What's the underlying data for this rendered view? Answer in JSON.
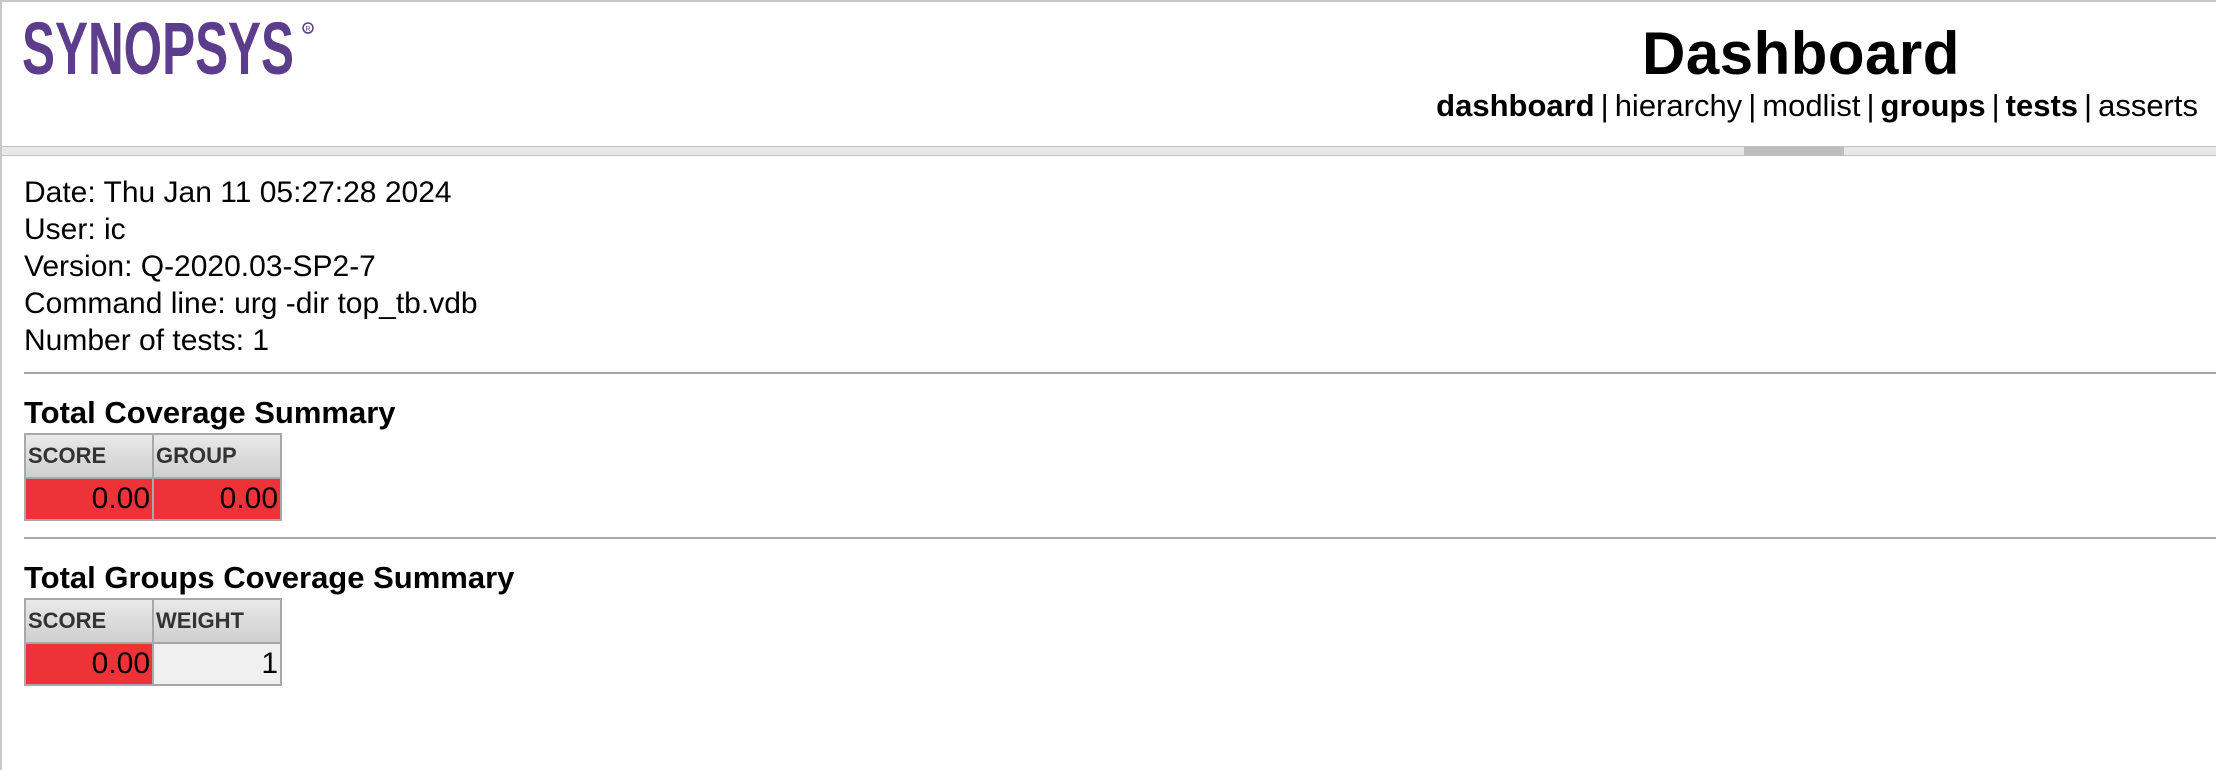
{
  "header": {
    "logo_text": "SYNOPSYS",
    "title": "Dashboard",
    "nav": [
      {
        "label": "dashboard",
        "bold": true
      },
      {
        "label": "hierarchy",
        "bold": false
      },
      {
        "label": "modlist",
        "bold": false
      },
      {
        "label": "groups",
        "bold": true
      },
      {
        "label": "tests",
        "bold": true
      },
      {
        "label": "asserts",
        "bold": false
      }
    ],
    "nav_separator": "|"
  },
  "info": {
    "date": "Date: Thu Jan 11 05:27:28 2024",
    "user": "User: ic",
    "version": "Version: Q-2020.03-SP2-7",
    "command_line": "Command line: urg -dir top_tb.vdb",
    "num_tests": "Number of tests: 1"
  },
  "total_coverage": {
    "title": "Total Coverage Summary",
    "headers": [
      "SCORE",
      "GROUP"
    ],
    "values": [
      "0.00",
      "0.00"
    ]
  },
  "groups_coverage": {
    "title": "Total Groups Coverage Summary",
    "headers": [
      "SCORE",
      "WEIGHT"
    ],
    "values": [
      "0.00",
      "1"
    ]
  },
  "colors": {
    "logo_purple": "#5b3d8c",
    "low_score_red": "#ee3338",
    "neutral_cell": "#f0f0f0"
  }
}
